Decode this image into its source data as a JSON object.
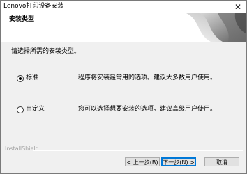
{
  "window": {
    "title": "Lenovo打印设备安装",
    "close_label": "✕"
  },
  "banner": {
    "title": "安装类型"
  },
  "content": {
    "instruction": "请选择所需的安装类型。",
    "options": [
      {
        "label": "标准",
        "description": "程序将安装最常用的选项。建议大多数用户使用。",
        "selected": true
      },
      {
        "label": "自定义",
        "description": "您可以选择想要安装的选项。建议高级用户使用。",
        "selected": false
      }
    ]
  },
  "footer": {
    "brand": "InstallShield",
    "back_label": "< 上一步(B)",
    "next_label": "下一步(N) >",
    "cancel_label": "取消"
  }
}
